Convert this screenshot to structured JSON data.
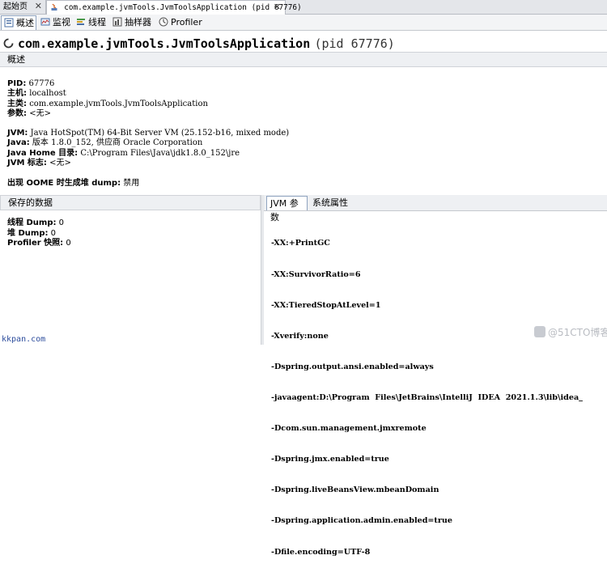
{
  "doc_tabs": {
    "start_label": "起始页",
    "app_label": "com.example.jvmTools.JvmToolsApplication (pid 67776)",
    "close_glyph": "✕"
  },
  "view_tabs": {
    "overview": "概述",
    "monitor": "监视",
    "threads": "线程",
    "sampler": "抽样器",
    "profiler": "Profiler"
  },
  "title": {
    "app": "com.example.jvmTools.JvmToolsApplication",
    "pid": "(pid 67776)"
  },
  "overview_header": "概述",
  "info": {
    "pid_key": "PID:",
    "pid_val": "67776",
    "host_key": "主机:",
    "host_val": "localhost",
    "main_class_key": "主类:",
    "main_class_val": "com.example.jvmTools.JvmToolsApplication",
    "args_key": "参数:",
    "args_val": "<无>",
    "jvm_key": "JVM:",
    "jvm_val": "Java HotSpot(TM) 64-Bit Server VM (25.152-b16, mixed mode)",
    "java_key": "Java:",
    "java_val": "版本 1.8.0_152, 供应商 Oracle Corporation",
    "java_home_key": "Java Home 目录:",
    "java_home_val": "C:\\Program Files\\Java\\jdk1.8.0_152\\jre",
    "jvm_flags_key": "JVM 标志:",
    "jvm_flags_val": "<无>",
    "oome_key": "出现 OOME 时生成堆 dump:",
    "oome_val": "禁用"
  },
  "saved_data": {
    "header": "保存的数据",
    "thread_dump_key": "线程 Dump:",
    "thread_dump_val": "0",
    "heap_dump_key": "堆 Dump:",
    "heap_dump_val": "0",
    "profiler_snap_key": "Profiler 快照:",
    "profiler_snap_val": "0"
  },
  "right_tabs": {
    "jvm_args": "JVM 参数",
    "sys_props": "系统属性"
  },
  "jvm_args": [
    "-XX:+PrintGC",
    "-XX:SurvivorRatio=6",
    "-XX:TieredStopAtLevel=1",
    "-Xverify:none",
    "-Dspring.output.ansi.enabled=always",
    "-javaagent:D:\\Program  Files\\JetBrains\\IntelliJ  IDEA  2021.1.3\\lib\\idea_",
    "-Dcom.sun.management.jmxremote",
    "-Dspring.jmx.enabled=true",
    "-Dspring.liveBeansView.mbeanDomain",
    "-Dspring.application.admin.enabled=true",
    "-Dfile.encoding=UTF-8"
  ],
  "watermarks": {
    "left": "kkpan.com",
    "right": "@51CTO博客"
  }
}
